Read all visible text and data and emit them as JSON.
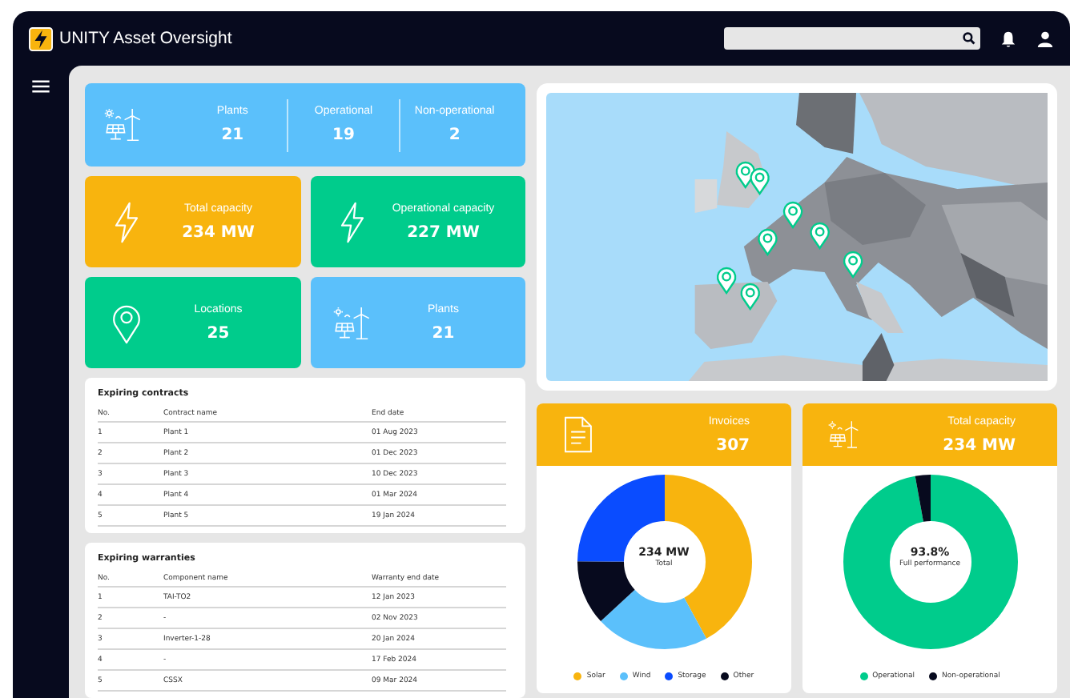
{
  "app": {
    "title": "UNITY Asset Oversight"
  },
  "summary": {
    "kind": "plants",
    "items": [
      {
        "label": "Plants",
        "value": "21"
      },
      {
        "label": "Operational",
        "value": "19"
      },
      {
        "label": "Non-operational",
        "value": "2"
      }
    ]
  },
  "tiles": [
    {
      "kind": "bolt",
      "label": "Total capacity",
      "value": "234 MW",
      "color": "#f8b40e"
    },
    {
      "kind": "bolt",
      "label": "Operational capacity",
      "value": "227 MW",
      "color": "#00cc8c"
    },
    {
      "kind": "pin",
      "label": "Locations",
      "value": "25",
      "color": "#00cc8c"
    },
    {
      "kind": "plants",
      "label": "Plants",
      "value": "21",
      "color": "#5bc0fb"
    }
  ],
  "tables": [
    {
      "title": "Expiring contracts",
      "columns": [
        "No.",
        "Contract name",
        "End date"
      ],
      "rows": [
        [
          "1",
          "Plant 1",
          "01 Aug 2023"
        ],
        [
          "2",
          "Plant 2",
          "01 Dec 2023"
        ],
        [
          "3",
          "Plant 3",
          "10 Dec 2023"
        ],
        [
          "4",
          "Plant 4",
          "01 Mar 2024"
        ],
        [
          "5",
          "Plant 5",
          "19 Jan 2024"
        ]
      ]
    },
    {
      "title": "Expiring warranties",
      "columns": [
        "No.",
        "Component name",
        "Warranty end date"
      ],
      "rows": [
        [
          "1",
          "TAI-TO2",
          "12 Jan 2023"
        ],
        [
          "2",
          "-",
          "02 Nov 2023"
        ],
        [
          "3",
          "Inverter-1-28",
          "20 Jan 2024"
        ],
        [
          "4",
          "-",
          "17 Feb 2024"
        ],
        [
          "5",
          "CSSX",
          "09 Mar 2024"
        ]
      ]
    }
  ],
  "kpi_cards": [
    {
      "kind": "document",
      "title": "Invoices",
      "value": "307",
      "center_value": "234 MW",
      "center_label": "Total",
      "legend": [
        {
          "label": "Solar",
          "color": "#f8b40e"
        },
        {
          "label": "Wind",
          "color": "#5bc0fb"
        },
        {
          "label": "Storage",
          "color": "#0a4cff"
        },
        {
          "label": "Other",
          "color": "#070a1e"
        }
      ]
    },
    {
      "kind": "plants",
      "title": "Total capacity",
      "value": "234 MW",
      "center_value": "93.8%",
      "center_label": "Full performance",
      "legend": [
        {
          "label": "Operational",
          "color": "#00cc8c"
        },
        {
          "label": "Non-operational",
          "color": "#070a1e"
        }
      ]
    }
  ]
}
